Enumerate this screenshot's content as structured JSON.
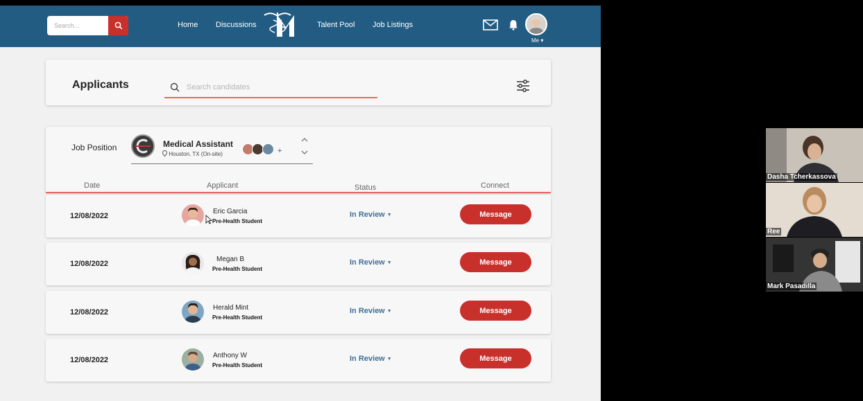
{
  "nav": {
    "search_placeholder": "Search...",
    "links": [
      "Home",
      "Discussions",
      "Talent Pool",
      "Job Listings"
    ],
    "me_label": "Me ▾"
  },
  "page": {
    "title": "Applicants",
    "search_placeholder": "Search candidates"
  },
  "job": {
    "label": "Job Position",
    "title": "Medical Assistant",
    "location": "Houston, TX (On-site)"
  },
  "columns": [
    "Date",
    "Applicant",
    "Status",
    "Connect"
  ],
  "applicants": [
    {
      "date": "12/08/2022",
      "name": "Eric Garcia",
      "subtitle": "Pre-Health Student",
      "status": "In Review",
      "action": "Message"
    },
    {
      "date": "12/08/2022",
      "name": "Megan B",
      "subtitle": "Pre-Health Student",
      "status": "In Review",
      "action": "Message"
    },
    {
      "date": "12/08/2022",
      "name": "Herald Mint",
      "subtitle": "Pre-Health Student",
      "status": "In Review",
      "action": "Message"
    },
    {
      "date": "12/08/2022",
      "name": "Anthony W",
      "subtitle": "Pre-Health Student",
      "status": "In Review",
      "action": "Message"
    }
  ],
  "participants": [
    "Dasha Tcherkassova",
    "Ree",
    "Mark Pasadilla"
  ],
  "colors": {
    "primary": "#235c82",
    "accent": "#c8302c",
    "status": "#3d6f9a"
  }
}
